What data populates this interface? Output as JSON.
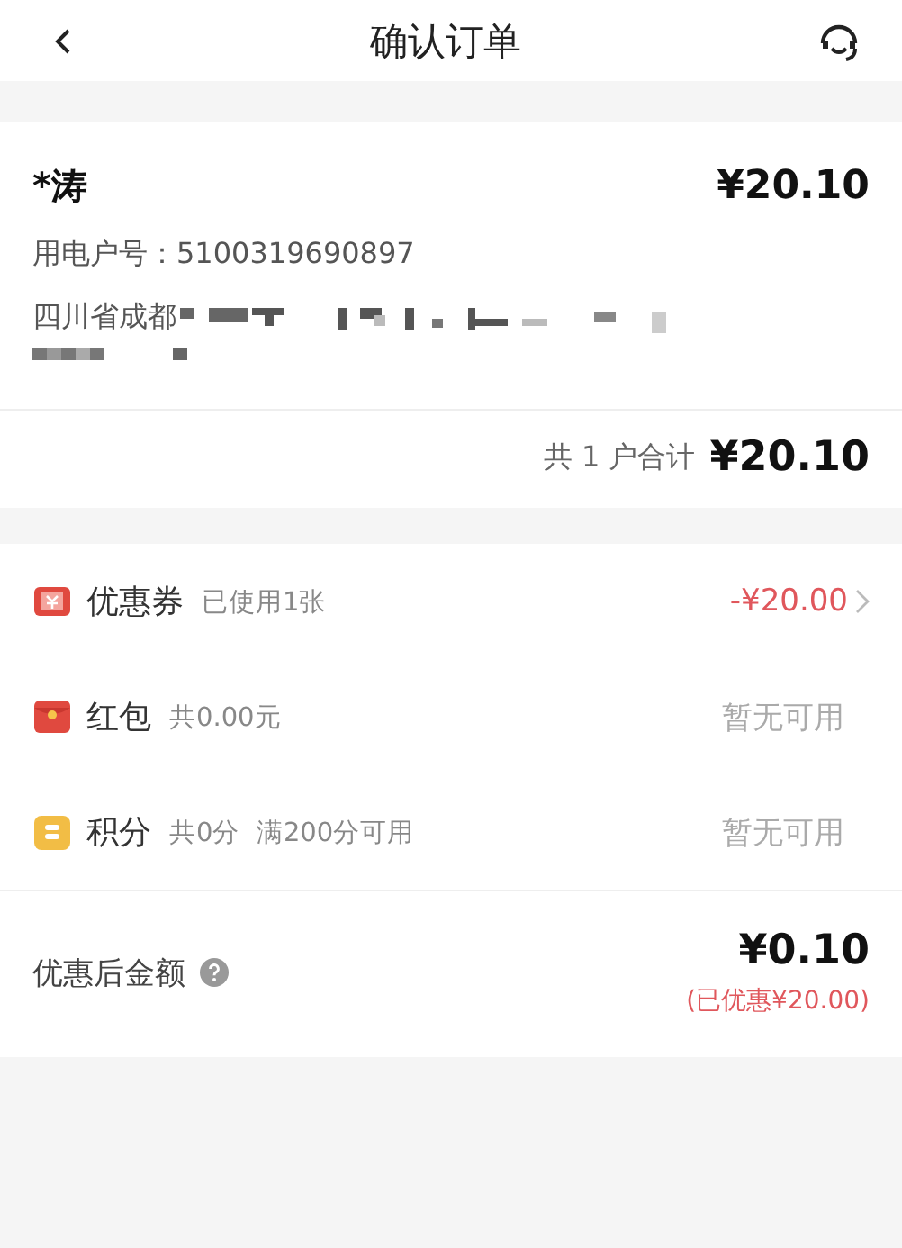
{
  "header": {
    "title": "确认订单"
  },
  "account": {
    "name": "*涛",
    "amount": "¥20.10",
    "account_label": "用电户号：",
    "account_number": "5100319690897",
    "address": "四川省成都",
    "address_redacted": true,
    "total_label": "共 1 户合计",
    "total_amount": "¥20.10"
  },
  "discounts": [
    {
      "kind": "coupon",
      "label": "优惠券",
      "detail": "已使用1张",
      "value": "-¥20.00",
      "available": true
    },
    {
      "kind": "red_packet",
      "label": "红包",
      "detail": "共0.00元",
      "value": "暂无可用",
      "available": false
    },
    {
      "kind": "points",
      "label": "积分",
      "detail": "共0分  满200分可用",
      "value": "暂无可用",
      "available": false
    }
  ],
  "summary": {
    "label": "优惠后金额",
    "amount": "¥0.10",
    "saved": "(已优惠¥20.00)"
  }
}
